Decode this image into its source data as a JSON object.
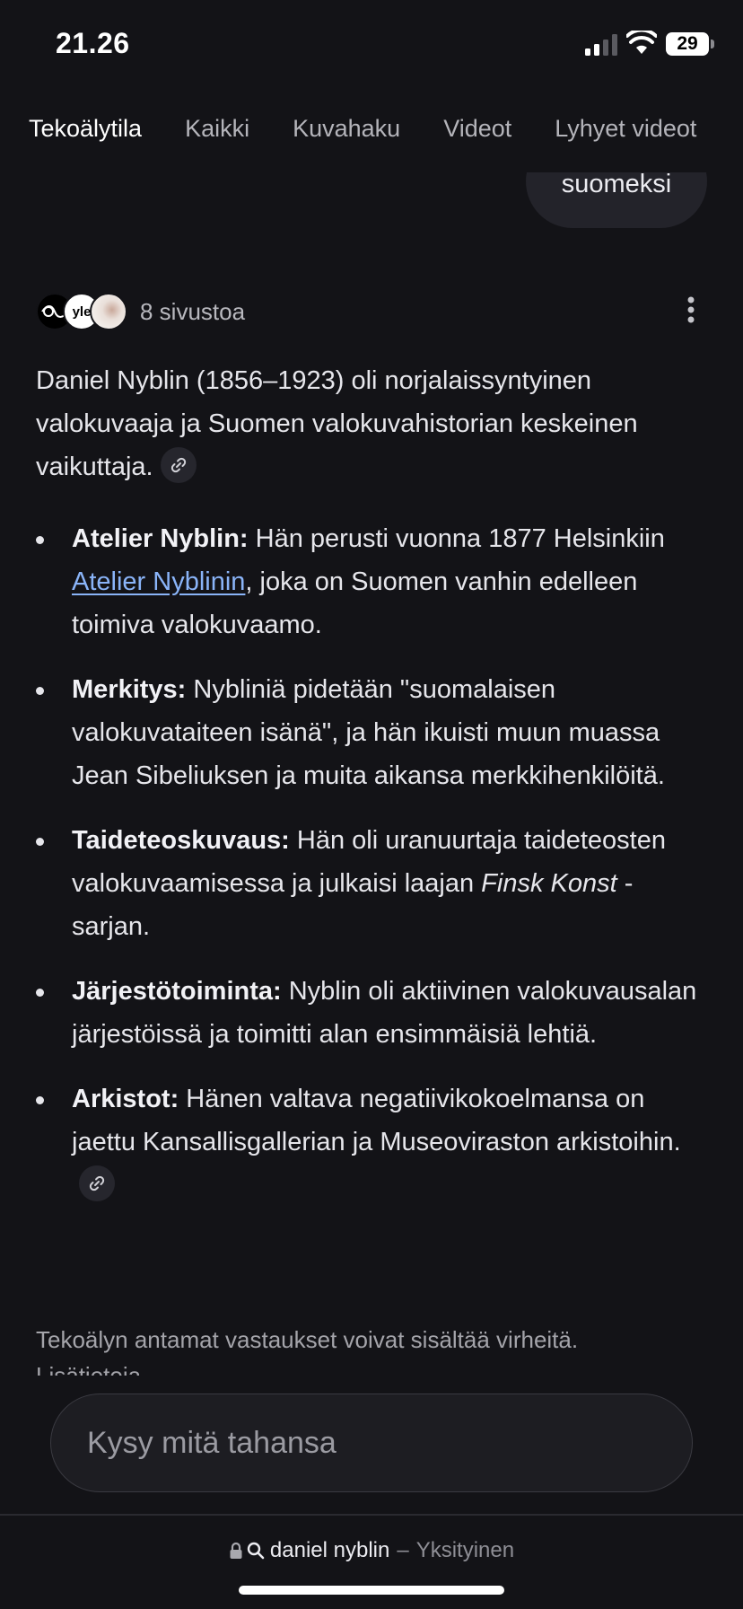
{
  "status_bar": {
    "time": "21.26",
    "battery": "29"
  },
  "tabs": [
    "Tekoälytila",
    "Kaikki",
    "Kuvahaku",
    "Videot",
    "Lyhyet videot"
  ],
  "query": "suomeksi",
  "sources": {
    "label": "8 sivustoa",
    "favicon_texts": [
      "yle"
    ]
  },
  "answer": {
    "intro": "Daniel Nyblin (1856–1923) oli norjalaissyntyinen valokuvaaja ja Suomen valokuvahistorian keskeinen vaikuttaja.",
    "bullets": [
      {
        "term": "Atelier Nyblin:",
        "pre": " Hän perusti vuonna 1877 Helsinkiin ",
        "link": "Atelier Nyblinin",
        "post": ", joka on Suomen vanhin edelleen toimiva valokuvaamo."
      },
      {
        "term": "Merkitys:",
        "text": " Nybliniä pidetään \"suomalaisen valokuvataiteen isänä\", ja hän ikuisti muun muassa Jean Sibeliuksen ja muita aikansa merkkihenkilöitä."
      },
      {
        "term": "Taideteoskuvaus:",
        "pre": " Hän oli uranuurtaja taideteosten valokuvaamisessa ja julkaisi laajan ",
        "italic": "Finsk Konst",
        "post": " -sarjan."
      },
      {
        "term": "Järjestötoiminta:",
        "text": " Nyblin oli aktiivinen valokuvausalan järjestöissä ja toimitti alan ensimmäisiä lehtiä."
      },
      {
        "term": "Arkistot:",
        "text": " Hänen valtava negatiivikokoelmansa on jaettu Kansallisgallerian ja Museoviraston arkistoihin."
      }
    ]
  },
  "disclaimer": "Tekoälyn antamat vastaukset voivat sisältää virheitä.",
  "disclaimer_more": "Lisätietoja",
  "ask_placeholder": "Kysy mitä tahansa",
  "url_bar": {
    "query": "daniel nyblin",
    "separator": "–",
    "mode": "Yksityinen"
  },
  "icons": [
    "signal-icon",
    "wifi-icon",
    "more-icon",
    "link-icon",
    "lock-icon",
    "search-icon"
  ]
}
